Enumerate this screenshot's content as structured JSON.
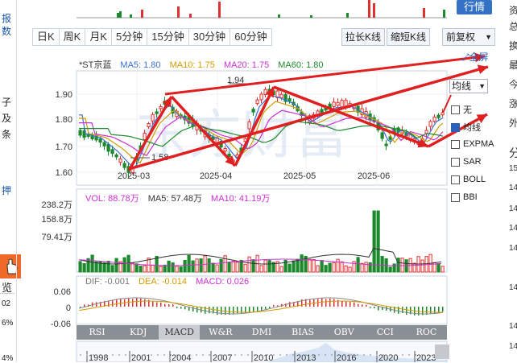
{
  "left_strip": {
    "chars": [
      "报",
      "数",
      "子",
      "及",
      "条",
      "押",
      "览",
      "02",
      "6%",
      "4%"
    ]
  },
  "right_strip": {
    "chars": [
      "资",
      "总",
      "换",
      "最",
      "今",
      "涨",
      "外",
      "分",
      "15",
      "14",
      "14",
      "14",
      "14",
      "14",
      "14",
      "14"
    ]
  },
  "top": {
    "detail_button": "行情"
  },
  "periods": {
    "items": [
      "日K",
      "周K",
      "月K",
      "5分钟",
      "15分钟",
      "30分钟",
      "60分钟"
    ],
    "active": 0
  },
  "tools": {
    "stretch": "拉长K线",
    "shrink": "缩短K线",
    "adjust": "前复权"
  },
  "main_legend": {
    "name": "*ST京蓝",
    "ma5": "MA5: 1.80",
    "ma10": "MA10: 1.75",
    "ma20": "MA20: 1.75",
    "ma60": "MA60: 1.80"
  },
  "annotations": {
    "high": "1.94",
    "low": "1.58"
  },
  "price_axis": [
    "1.90",
    "1.80",
    "1.70",
    "1.60"
  ],
  "date_axis": [
    "2025-03",
    "2025-04",
    "2025-05",
    "2025-06"
  ],
  "vol_legend": {
    "vol": "VOL: 88.78万",
    "ma5": "MA5: 57.48万",
    "ma10": "MA10: 41.19万"
  },
  "vol_axis": [
    "238.2万",
    "158.8万",
    "79.41万"
  ],
  "macd_legend": {
    "dif": "DIF: -0.001",
    "dea": "DEA: -0.014",
    "macd": "MACD: 0.026"
  },
  "macd_axis": [
    "0.06",
    "0",
    "-0.06"
  ],
  "indicator_tabs": [
    "RSI",
    "KDJ",
    "MACD",
    "W&R",
    "DMI",
    "BIAS",
    "OBV",
    "CCI",
    "ROC"
  ],
  "indicator_active": 2,
  "years": [
    "1998",
    "2001",
    "2004",
    "2007",
    "2010",
    "2013",
    "2016",
    "2020",
    "2023"
  ],
  "side_options": {
    "title": "均线",
    "full": "全屏",
    "items": [
      "无",
      "均线",
      "EXPMA",
      "SAR",
      "BOLL",
      "BBI"
    ],
    "checked": 1
  },
  "colors": {
    "up": "#e03030",
    "down": "#1c8a2c",
    "accent": "#3472c5",
    "arrow": "#e02020"
  }
}
